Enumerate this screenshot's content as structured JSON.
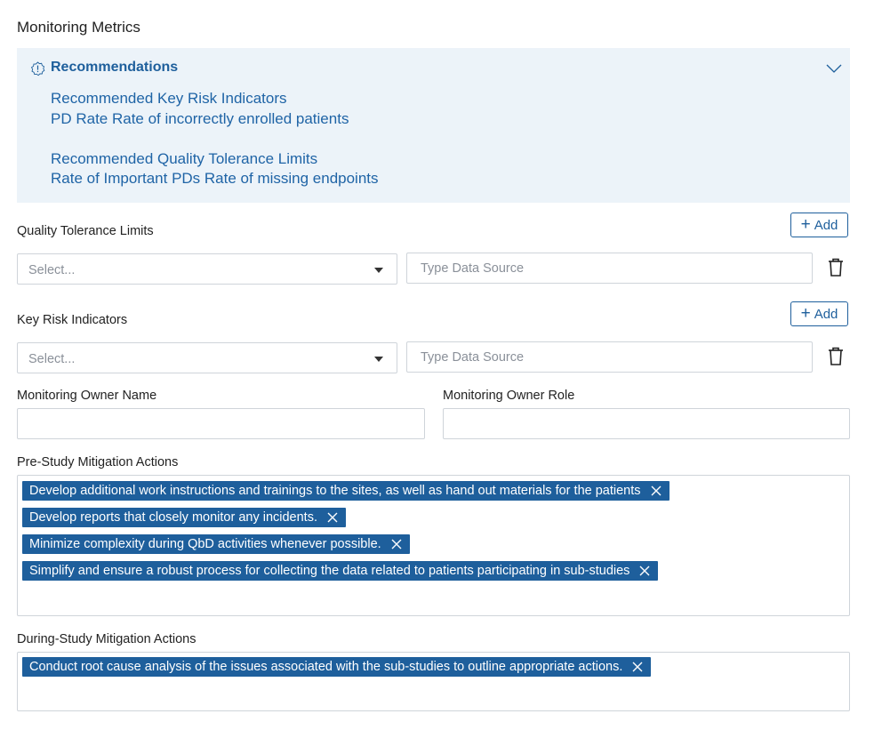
{
  "section_title": "Monitoring Metrics",
  "recommendations": {
    "title": "Recommendations",
    "icon": "info-badge-icon",
    "lines": [
      "Recommended Key Risk Indicators",
      "PD Rate Rate of incorrectly enrolled patients",
      "Recommended Quality Tolerance Limits",
      "Rate of Important PDs Rate of missing endpoints"
    ]
  },
  "qtl": {
    "label": "Quality Tolerance Limits",
    "add_label": "Add",
    "select_placeholder": "Select...",
    "source_placeholder": "Type Data Source"
  },
  "kri": {
    "label": "Key Risk Indicators",
    "add_label": "Add",
    "select_placeholder": "Select...",
    "source_placeholder": "Type Data Source"
  },
  "owner": {
    "name_label": "Monitoring Owner Name",
    "name_value": "",
    "role_label": "Monitoring Owner Role",
    "role_value": ""
  },
  "pre_study": {
    "label": "Pre-Study Mitigation Actions",
    "tags": [
      "Develop additional work instructions and trainings to the sites, as well as hand out materials for the patients",
      "Develop reports that closely monitor any incidents.",
      "Minimize complexity during QbD activities whenever possible.",
      "Simplify and ensure a robust process for collecting the data related to patients participating in sub-studies"
    ]
  },
  "during_study": {
    "label": "During-Study Mitigation Actions",
    "tags": [
      "Conduct root cause analysis of the issues associated with the sub-studies to outline appropriate actions."
    ]
  },
  "colors": {
    "accent": "#1e5f9c",
    "panel_bg": "#ecf3f9",
    "tag_bg": "#1e5f9c"
  }
}
